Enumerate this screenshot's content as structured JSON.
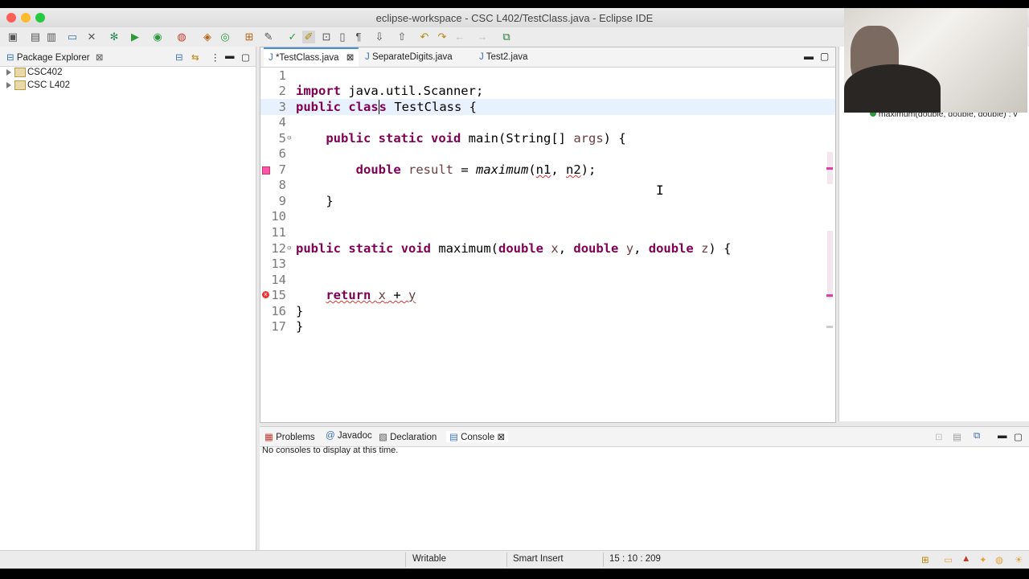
{
  "window": {
    "title": "eclipse-workspace - CSC L402/TestClass.java - Eclipse IDE"
  },
  "package_explorer": {
    "tab_label": "Package Explorer",
    "projects": [
      "CSC402",
      "CSC L402"
    ]
  },
  "editor": {
    "tabs": [
      {
        "label": "*TestClass.java",
        "active": true
      },
      {
        "label": "SeparateDigits.java",
        "active": false
      },
      {
        "label": "Test2.java",
        "active": false
      }
    ],
    "lines": [
      {
        "n": "1",
        "text": ""
      },
      {
        "n": "2",
        "text": "import java.util.Scanner;"
      },
      {
        "n": "3",
        "text": "public class TestClass {"
      },
      {
        "n": "4",
        "text": ""
      },
      {
        "n": "5",
        "text": "    public static void main(String[] args) {"
      },
      {
        "n": "6",
        "text": ""
      },
      {
        "n": "7",
        "text": "        double result = maximum(n1, n2);"
      },
      {
        "n": "8",
        "text": ""
      },
      {
        "n": "9",
        "text": "    }"
      },
      {
        "n": "10",
        "text": ""
      },
      {
        "n": "11",
        "text": ""
      },
      {
        "n": "12",
        "text": "public static void maximum(double x, double y, double z) {"
      },
      {
        "n": "13",
        "text": ""
      },
      {
        "n": "14",
        "text": ""
      },
      {
        "n": "15",
        "text": "    return x + y"
      },
      {
        "n": "16",
        "text": "}"
      },
      {
        "n": "17",
        "text": "}"
      }
    ]
  },
  "outline": {
    "item": "maximum(double, double, double) : v"
  },
  "bottom_panel": {
    "tabs": [
      "Problems",
      "Javadoc",
      "Declaration",
      "Console"
    ],
    "active_tab": "Console",
    "message": "No consoles to display at this time."
  },
  "status_bar": {
    "mode": "Writable",
    "insert": "Smart Insert",
    "position": "15 : 10 : 209"
  },
  "colors": {
    "keyword": "#7f0055",
    "variable": "#6a3e3e",
    "error": "#d33333",
    "active_tab": "#4a8fd9"
  }
}
